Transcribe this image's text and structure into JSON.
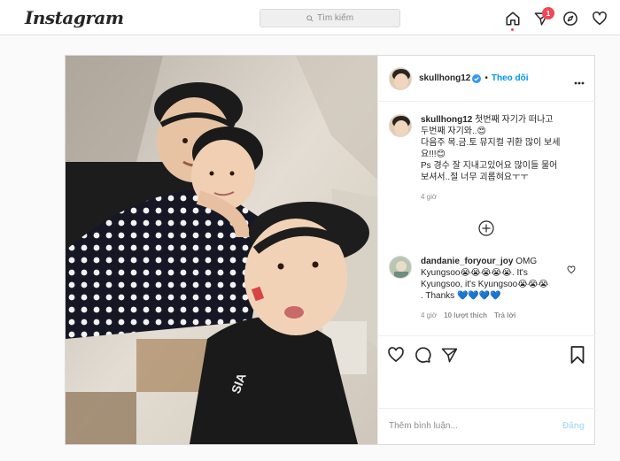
{
  "nav": {
    "logo": "Instagram",
    "search_placeholder": "Tìm kiếm",
    "badge_count": "1",
    "icons": [
      "home-icon",
      "direct-icon",
      "explore-icon",
      "activity-heart-icon"
    ]
  },
  "post": {
    "username": "skullhong12",
    "follow_label": "Theo dõi",
    "caption_lines": [
      "첫번째 자기가 떠나고",
      "두번째 자기와..😍",
      "다음주 목.금.토 뮤지컬 귀환 많이 보세",
      "요!!!😊",
      "Ps 경수 잘 지내고있어요 많이들 물어",
      "보셔서..절 너무 괴롭혀요ㅜㅜ"
    ],
    "caption_time": "4 giờ",
    "comment": {
      "username": "dandanie_foryour_joy",
      "text_lines": [
        "OMG",
        "Kyungsoo😭😭😭😭😭. It's",
        "Kyungsoo, it's Kyungsoo😭😭😭",
        ". Thanks 💙💙💙💙"
      ],
      "time": "4 giờ",
      "likes": "10 lượt thích",
      "reply": "Trả lời"
    },
    "add_comment_placeholder": "Thêm bình luận...",
    "post_button": "Đăng"
  },
  "colors": {
    "accent": "#0095f6",
    "badge": "#ed4956",
    "muted": "#8e8e8e",
    "border": "#dbdbdb",
    "post_disabled": "#b2dffc"
  }
}
